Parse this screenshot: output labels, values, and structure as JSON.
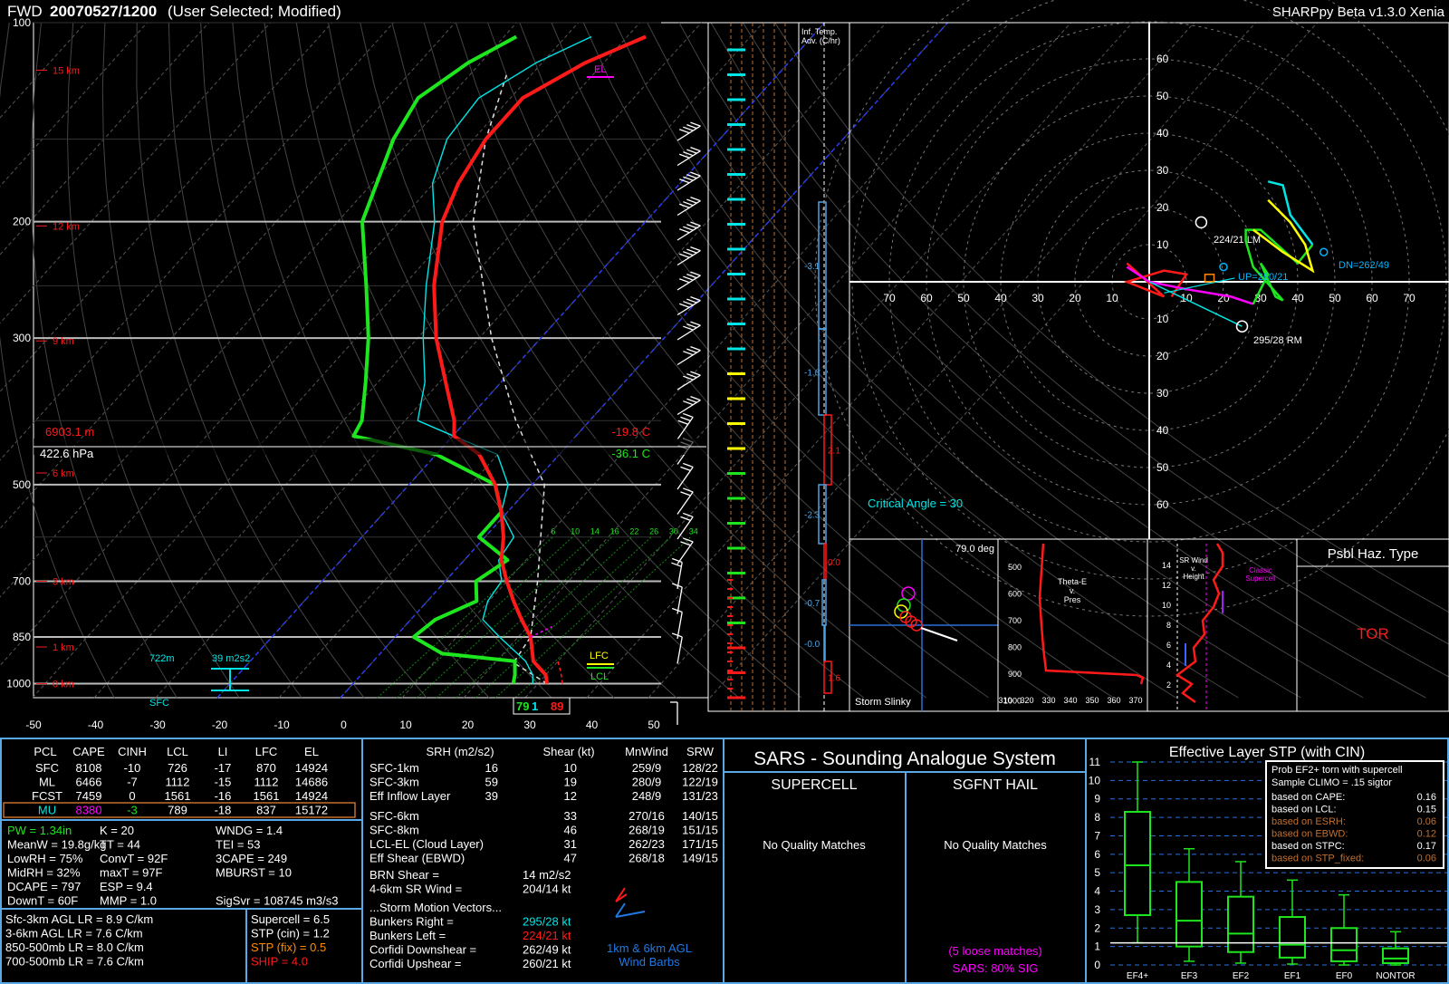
{
  "header": {
    "station": "FWD",
    "datetime": "20070527/1200",
    "mode": "(User Selected; Modified)",
    "app": "SHARPpy Beta v1.3.0 Xenia"
  },
  "colors": {
    "temp": "#ff1a1a",
    "dewp": "#1ee61e",
    "wetbulb": "#00e5e5",
    "parcel": "#ffffff",
    "isobar": "#bbbbbb",
    "frame": "#5aa9e6",
    "magenta": "#ff00ff",
    "yellow": "#ffff00",
    "orange": "#ff8c00",
    "cyan": "#00e5e5",
    "green": "#1ee61e",
    "red": "#ff1a1a"
  },
  "skewt": {
    "pressure_labels": [
      "100",
      "200",
      "300",
      "500",
      "700",
      "850",
      "1000"
    ],
    "height_labels": [
      "15 km",
      "12 km",
      "9 km",
      "6 km",
      "3 km",
      "1 km",
      "0 km"
    ],
    "temp_ticks": [
      "-50",
      "-40",
      "-30",
      "-20",
      "-10",
      "0",
      "10",
      "20",
      "30",
      "40",
      "50"
    ],
    "cursor_height": "6903.1 m",
    "cursor_pressure": "422.6 hPa",
    "cursor_temp": "-19.8 C",
    "cursor_dewp": "-36.1 C",
    "el_label": "EL",
    "lfc_label": "LFC",
    "lcl_label": "LCL",
    "sfc_label": "SFC",
    "height_722": "722m",
    "srh_label": "39 m2s2",
    "sfc_temp": "89",
    "sfc_dewp": "79",
    "sfc_wetbulb": "1",
    "mix_ratios": [
      "6",
      "10",
      "14",
      "16",
      "22",
      "26",
      "30",
      "34"
    ]
  },
  "chart_data": [
    {
      "type": "line",
      "title": "",
      "series": [
        {
          "name": "Temperature",
          "points": [
            [
              1000,
              31.5
            ],
            [
              970,
              30
            ],
            [
              925,
              26
            ],
            [
              850,
              22
            ],
            [
              800,
              18
            ],
            [
              750,
              14
            ],
            [
              700,
              10
            ],
            [
              650,
              6
            ],
            [
              600,
              3
            ],
            [
              550,
              -1
            ],
            [
              500,
              -6
            ],
            [
              450,
              -13
            ],
            [
              422,
              -19.8
            ],
            [
              400,
              -22
            ],
            [
              350,
              -29
            ],
            [
              300,
              -37
            ],
            [
              250,
              -45
            ],
            [
              200,
              -53
            ],
            [
              175,
              -56
            ],
            [
              150,
              -58
            ],
            [
              130,
              -58
            ],
            [
              115,
              -53
            ],
            [
              105,
              -47
            ]
          ]
        },
        {
          "name": "Dewpoint",
          "points": [
            [
              1000,
              26
            ],
            [
              970,
              25
            ],
            [
              925,
              23
            ],
            [
              900,
              10
            ],
            [
              850,
              3
            ],
            [
              800,
              4
            ],
            [
              750,
              8
            ],
            [
              700,
              5
            ],
            [
              650,
              7
            ],
            [
              600,
              -1
            ],
            [
              550,
              -1
            ],
            [
              500,
              -6
            ],
            [
              450,
              -20
            ],
            [
              422,
              -36.1
            ],
            [
              400,
              -37
            ],
            [
              350,
              -42
            ],
            [
              300,
              -48
            ],
            [
              250,
              -56
            ],
            [
              200,
              -66
            ],
            [
              150,
              -73
            ],
            [
              130,
              -75
            ],
            [
              115,
              -72
            ],
            [
              105,
              -68
            ]
          ]
        }
      ]
    },
    {
      "type": "table",
      "title": "Thermodynamic indices",
      "columns": [
        "PCL",
        "CAPE",
        "CINH",
        "LCL",
        "LI",
        "LFC",
        "EL"
      ],
      "rows": [
        [
          "SFC",
          "8108",
          "-10",
          "726",
          "-17",
          "870",
          "14924"
        ],
        [
          "ML",
          "6466",
          "-7",
          "1112",
          "-15",
          "1112",
          "14686"
        ],
        [
          "FCST",
          "7459",
          "0",
          "1561",
          "-16",
          "1561",
          "14924"
        ],
        [
          "MU",
          "8380",
          "-3",
          "789",
          "-18",
          "837",
          "15172"
        ]
      ]
    },
    {
      "type": "table",
      "title": "Kinematic parameters",
      "columns": [
        "SRH (m2/s2)",
        "Shear (kt)",
        "MnWind",
        "SRW"
      ],
      "rows": [
        [
          "SFC-1km",
          "16",
          "10",
          "259/9",
          "128/22"
        ],
        [
          "SFC-3km",
          "59",
          "19",
          "280/9",
          "122/19"
        ],
        [
          "Eff Inflow Layer",
          "39",
          "12",
          "248/9",
          "131/23"
        ],
        [
          "SFC-6km",
          "",
          "33",
          "270/16",
          "140/15"
        ],
        [
          "SFC-8km",
          "",
          "46",
          "268/19",
          "151/15"
        ],
        [
          "LCL-EL (Cloud Layer)",
          "",
          "31",
          "262/23",
          "171/15"
        ],
        [
          "Eff Shear (EBWD)",
          "",
          "47",
          "268/18",
          "149/15"
        ]
      ]
    },
    {
      "type": "bar",
      "title": "Effective Layer STP (with CIN)",
      "categories": [
        "EF4+",
        "EF3",
        "EF2",
        "EF1",
        "EF0",
        "NONTOR"
      ],
      "boxes": [
        {
          "whisker_low": 1.2,
          "q1": 2.7,
          "median": 5.4,
          "q3": 8.3,
          "whisker_high": 11
        },
        {
          "whisker_low": 0.2,
          "q1": 1,
          "median": 2.4,
          "q3": 4.5,
          "whisker_high": 6.3
        },
        {
          "whisker_low": 0.1,
          "q1": 0.7,
          "median": 1.7,
          "q3": 3.7,
          "whisker_high": 5.6
        },
        {
          "whisker_low": 0.05,
          "q1": 0.4,
          "median": 1.1,
          "q3": 2.6,
          "whisker_high": 4.6
        },
        {
          "whisker_low": 0,
          "q1": 0.2,
          "median": 0.8,
          "q3": 2,
          "whisker_high": 3.8
        },
        {
          "whisker_low": 0,
          "q1": 0.1,
          "median": 0.35,
          "q3": 0.9,
          "whisker_high": 1.8
        }
      ],
      "ylim": [
        0,
        11
      ],
      "yticks": [
        "0",
        "1",
        "2",
        "3",
        "4",
        "5",
        "6",
        "7",
        "8",
        "9",
        "10",
        "11"
      ],
      "stp_value": 1.2
    }
  ],
  "cols": {
    "srh": "SRH (m2/s2)",
    "shear": "Shear (kt)",
    "mnwind": "MnWind",
    "srw": "SRW"
  },
  "indices": {
    "left": [
      {
        "t": "PW = 1.34in",
        "c": "green"
      },
      {
        "t": "MeanW = 19.8g/kg",
        "c": "white"
      },
      {
        "t": "LowRH = 75%",
        "c": "white"
      },
      {
        "t": "MidRH = 32%",
        "c": "white"
      },
      {
        "t": "DCAPE = 797",
        "c": "white"
      },
      {
        "t": "DownT = 60F",
        "c": "white"
      }
    ],
    "mid": [
      "K = 20",
      "TT = 44",
      "ConvT = 92F",
      "maxT = 97F",
      "ESP = 9.4",
      "MMP = 1.0"
    ],
    "right": [
      "WNDG = 1.4",
      "TEI = 53",
      "3CAPE = 249",
      "MBURST = 10",
      "",
      ""
    ],
    "sigsvr": "SigSvr = 108745 m3/s3"
  },
  "lapse": [
    "Sfc-3km AGL LR = 8.9 C/km",
    "3-6km AGL LR = 7.6 C/km",
    "850-500mb LR = 8.0 C/km",
    "700-500mb LR = 7.6 C/km"
  ],
  "composite": [
    {
      "t": "Supercell = 6.5",
      "c": "white"
    },
    {
      "t": "STP (cin) = 1.2",
      "c": "white"
    },
    {
      "t": "STP (fix) = 0.5",
      "c": "orange"
    },
    {
      "t": "SHIP = 4.0",
      "c": "red"
    }
  ],
  "kin_extra": {
    "brn": "BRN Shear =",
    "brn_val": "14 m2/s2",
    "sr46": "4-6km SR Wind =",
    "sr46_val": "204/14 kt",
    "storm_header": "...Storm Motion Vectors...",
    "vectors": [
      {
        "l": "Bunkers Right =",
        "v": "295/28 kt",
        "c": "cyan"
      },
      {
        "l": "Bunkers Left =",
        "v": "224/21 kt",
        "c": "red"
      },
      {
        "l": "Corfidi Downshear =",
        "v": "262/49 kt",
        "c": "white"
      },
      {
        "l": "Corfidi Upshear =",
        "v": "260/21 kt",
        "c": "white"
      }
    ],
    "barb_label1": "1km & 6km AGL",
    "barb_label2": "Wind Barbs"
  },
  "sars": {
    "title": "SARS - Sounding Analogue System",
    "supercell": "SUPERCELL",
    "hail": "SGFNT HAIL",
    "sup_result": "No Quality Matches",
    "hail_result": "No Quality Matches",
    "loose": "(5 loose matches)",
    "sig": "SARS: 80% SIG"
  },
  "stp_box": {
    "title": "Prob EF2+ torn with supercell",
    "climo": "Sample CLIMO = .15 sigtor",
    "rows": [
      {
        "l": "based on CAPE:",
        "v": "0.16",
        "c": "white"
      },
      {
        "l": "based on LCL:",
        "v": "0.15",
        "c": "white"
      },
      {
        "l": "based on ESRH:",
        "v": "0.06",
        "c": "orange"
      },
      {
        "l": "based on EBWD:",
        "v": "0.12",
        "c": "orange"
      },
      {
        "l": "based on STPC:",
        "v": "0.17",
        "c": "white"
      },
      {
        "l": "based on STP_fixed:",
        "v": "0.06",
        "c": "orange"
      }
    ]
  },
  "hodo": {
    "rings": [
      "10",
      "20",
      "30",
      "40",
      "50",
      "60",
      "70"
    ],
    "lm": "224/21 LM",
    "rm": "295/28 RM",
    "dn": "DN=262/49",
    "up": "UP=260/21",
    "critical": "Critical Angle = 30"
  },
  "inset": {
    "temp_adv_title1": "Inf. Temp.",
    "temp_adv_title2": "Adv. (C/hr)",
    "adv_values": [
      "-3.1",
      "-1.6",
      "2.1",
      "-2.3",
      "0.0",
      "-0.7",
      "-0.0",
      "1.6"
    ],
    "slinky_label": "Storm Slinky",
    "slinky_deg": "79.0 deg",
    "thetae_title": "Theta-E\nv.\nPres",
    "thetae_xticks": [
      "310",
      "320",
      "330",
      "340",
      "350",
      "360",
      "370"
    ],
    "thetae_yticks": [
      "500",
      "600",
      "700",
      "800",
      "900",
      "1000"
    ],
    "srwind_title": "SR Wind\nv.\nHeight",
    "srwind_yticks": [
      "2",
      "4",
      "6",
      "8",
      "10",
      "12",
      "14"
    ],
    "classic": "Classic\nSupercell",
    "haz_title": "Psbl Haz. Type",
    "haz_value": "TOR"
  }
}
